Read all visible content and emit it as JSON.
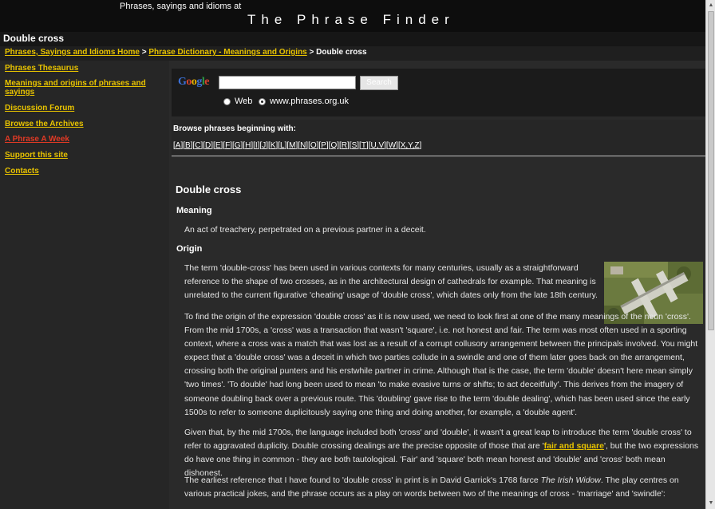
{
  "header": {
    "tagline": "Phrases, sayings and idioms at",
    "site_title": "The Phrase Finder"
  },
  "page": {
    "heading": "Double cross"
  },
  "breadcrumb": {
    "home": "Phrases, Sayings and Idioms Home",
    "separator": ">",
    "dictionary": "Phrase Dictionary - Meanings and Origins",
    "current": "Double cross"
  },
  "sidebar": {
    "items": [
      {
        "label": "Phrases Thesaurus"
      },
      {
        "label": "Meanings and origins of phrases and sayings"
      },
      {
        "label": "Discussion Forum"
      },
      {
        "label": "Browse the Archives"
      },
      {
        "label": "A Phrase A Week"
      },
      {
        "label": "Support this site"
      },
      {
        "label": "Contacts"
      }
    ]
  },
  "search": {
    "logo": "Google",
    "input_value": "",
    "button_label": "Search",
    "options": [
      {
        "label": "Web",
        "selected": false
      },
      {
        "label": "www.phrases.org.uk",
        "selected": true
      }
    ]
  },
  "browse": {
    "label": "Browse phrases beginning with:",
    "letters": [
      "A",
      "B",
      "C",
      "D",
      "E",
      "F",
      "G",
      "H",
      "I",
      "J",
      "K",
      "L",
      "M",
      "N",
      "O",
      "P",
      "Q",
      "R",
      "S",
      "T",
      "U,V",
      "W",
      "X,Y,Z"
    ]
  },
  "article": {
    "title": "Double cross",
    "meaning_heading": "Meaning",
    "meaning_text": "An act of treachery, perpetrated on a previous partner in a deceit.",
    "origin_heading": "Origin",
    "p1": "The term 'double-cross' has been used in various contexts for many centuries, usually as a straightforward reference to the shape of two crosses, as in the architectural design of cathedrals for example. That meaning is unrelated to the current figurative 'cheating' usage of 'double cross', which dates only from the late 18th century.",
    "p2": "To find the origin of the expression 'double cross' as it is now used, we need to look first at one of the many meanings of the noun 'cross'. From the mid 1700s, a 'cross' was a transaction that wasn't 'square', i.e. not honest and fair. The term was most often used in a sporting context, where a cross was a match that was lost as a result of a corrupt collusory arrangement between the principals involved. You might expect that a 'double cross' was a deceit in which two parties collude in a swindle and one of them later goes back on the arrangement, crossing both the original punters and his erstwhile partner in crime. Although that is the case, the term 'double' doesn't here mean simply 'two times'. 'To double' had long been used to mean 'to make evasive turns or shifts; to act deceitfully'. This derives from the imagery of someone doubling back over a previous route. This 'doubling' gave rise to the term 'double dealing', which has been used since the early 1500s to refer to someone duplicitously saying one thing and doing another, for example, a 'double agent'.",
    "p3_before": "Given that, by the mid 1700s, the language included both 'cross' and 'double', it wasn't a great leap to introduce the term 'double cross' to refer to aggravated duplicity. Double crossing dealings are the precise opposite of those that are '",
    "p3_link": "fair and square",
    "p3_after": "', but the two expressions do have one thing in common - they are both tautological. 'Fair' and 'square' both mean honest and 'double' and 'cross' both mean dishonest.",
    "p4_before": "The earliest reference that I have found to 'double cross' in print is in David Garrick's 1768 farce ",
    "p4_italic": "The Irish Widow",
    "p4_after": ". The play centres on various practical jokes, and the phrase occurs as a play on words between two of the meanings of cross - 'marriage' and 'swindle':"
  },
  "colors": {
    "background": "#2a2a2a",
    "header": "#0d0d0d",
    "link": "#e8c300",
    "highlight_link": "#e23a25",
    "text": "#e6e6e6"
  }
}
